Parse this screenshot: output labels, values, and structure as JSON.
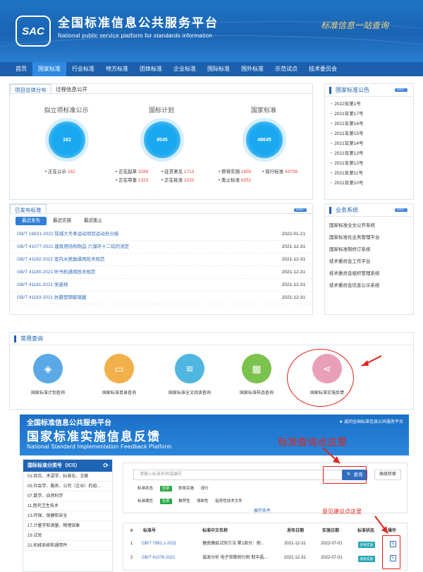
{
  "header": {
    "logo": "SAC",
    "title": "全国标准信息公共服务平台",
    "subtitle": "National public service platform  for standards information",
    "slogan": "标准信息一站查询"
  },
  "nav": [
    "首页",
    "国家标准",
    "行业标准",
    "地方标准",
    "团体标准",
    "企业标准",
    "国际标准",
    "国外标准",
    "示范试点",
    "技术委员会"
  ],
  "overview": {
    "tabs": [
      "项目总体分布",
      "过程信息公开"
    ],
    "stats": [
      {
        "title": "拟立项标准公示",
        "value": "162",
        "lines": [
          [
            "• 正在公示",
            "162"
          ]
        ]
      },
      {
        "title": "国标计划",
        "value": "8545",
        "lines": [
          [
            "• 正在起草",
            "3289"
          ],
          [
            "• 征求意见",
            "1713"
          ],
          [
            "• 正在审查",
            "1323"
          ],
          [
            "• 正在批准",
            "2220"
          ]
        ]
      },
      {
        "title": "国家标准",
        "value": "48645",
        "lines": [
          [
            "• 即将实施",
            "1655"
          ],
          [
            "• 现行标准",
            "43708"
          ],
          [
            "• 废止标准",
            "6252"
          ]
        ]
      }
    ]
  },
  "announce": {
    "title": "国家标准公告",
    "more": "MORE ›",
    "items": [
      "2022年第1号",
      "2021年第17号",
      "2021年第16号",
      "2021年第15号",
      "2021年第14号",
      "2021年第13号",
      "2021年第12号",
      "2021年第11号",
      "2021年第10号"
    ]
  },
  "published": {
    "title": "已发布标准",
    "more": "MORE ›",
    "subtabs": [
      "最近发布",
      "最近实施",
      "最近废止"
    ],
    "rows": [
      [
        "GB/T 16931-2022 陆域大冬季运动项目运动员分级",
        "2022-01-21"
      ],
      [
        "GB/T 41077-2021 建筑用结构制品 六溴环十二烷的测定",
        "2021-12-31"
      ],
      [
        "GB/T 41182-2021 室内水质器通用技术规范",
        "2021-12-31"
      ],
      [
        "GB/T 41180-2021 听书机通用技术规范",
        "2021-12-31"
      ],
      [
        "GB/T 41181-2021 坐姿椅",
        "2021-12-31"
      ],
      [
        "GB/T 41183-2021 抗菌塑钢玻璃器",
        "2021-12-31"
      ]
    ]
  },
  "systems": {
    "title": "业务系统",
    "more": "MORE ›",
    "items": [
      "国家标准全文公开系统",
      "国家标准化业务管理平台",
      "国家标准制修订系统",
      "技术委员会工作平台",
      "技术委员会组织管理系统",
      "技术委员会信息公示系统"
    ]
  },
  "common": {
    "title": "常用查询",
    "items": [
      "国家标准计划查询",
      "国家标准目录查询",
      "国家标准全文阅读查询",
      "国家标准样品查询",
      "国家标准实施反馈"
    ]
  },
  "feedback": {
    "top": "全国标准信息公共服务平台",
    "title": "国家标准实施信息反馈",
    "en": "National Standard Implementation Feedback Platform",
    "link": "★ 返回全国标准信息公共服务平台"
  },
  "ics": {
    "title": "国际标准分类号（ICS）",
    "refresh": "⟳",
    "items": [
      "01.综合、术语学、标准化、文献",
      "03.社会学、服务、公司（企业）的组...",
      "07.数学、自然科学",
      "11.医药卫生技术",
      "13.环保、保健和安全",
      "17.计量学和测量、物理现象",
      "19.试验",
      "21.机械系统和通用件"
    ]
  },
  "search": {
    "placeholder": "请输入标准名称或编号",
    "button": "🔍 查询",
    "advanced": "高级检索",
    "status_label": "标准状态",
    "status": [
      "全部",
      "即将实施",
      "现行"
    ],
    "attr_label": "标准属性",
    "attr": [
      "全部",
      "推荐性",
      "强制性",
      "指导性技术文件"
    ],
    "expand": "展开条件"
  },
  "table": {
    "headers": [
      "#",
      "标准号",
      "标准中文名称",
      "发布日期",
      "实施日期",
      "标准状态",
      "操作"
    ],
    "rows": [
      [
        "1",
        "GB/T 7991.1-2021",
        "搪瓷搪层试验方法 第1部分：耐...",
        "2021-12-31",
        "2022-07-01",
        "即将实施",
        "✎"
      ],
      [
        "2",
        "GB/T 41076-2021",
        "谐波分析 电子背散射衍射 取中晶...",
        "2021-12-31",
        "2022-07-01",
        "即将实施",
        "✎"
      ]
    ]
  },
  "annotations": {
    "query": "标准查询点这里",
    "suggest": "意见建议点这里"
  },
  "colors": {
    "nav": "#1b5fad",
    "accent": "#2f8ae3",
    "highlight": "#e2231a"
  }
}
